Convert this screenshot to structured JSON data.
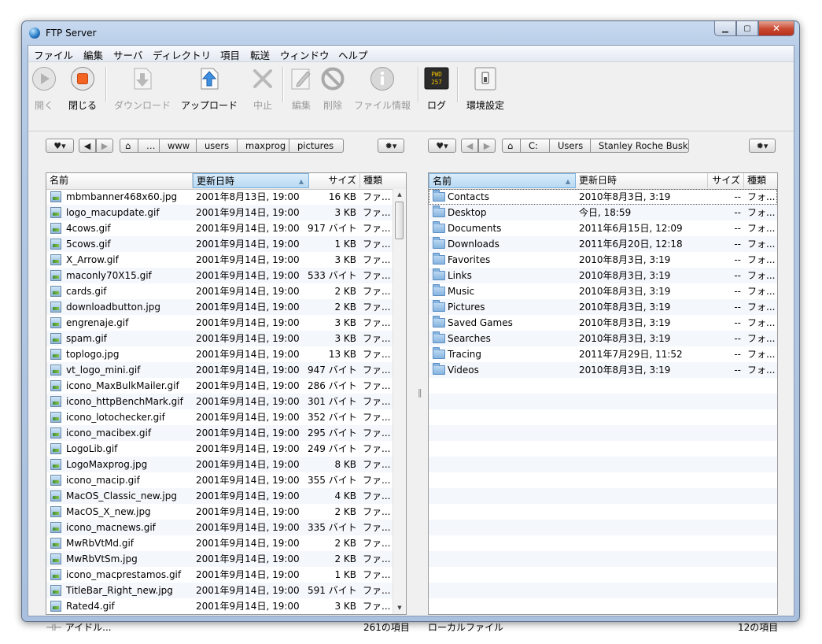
{
  "window": {
    "title": "FTP Server"
  },
  "menu": [
    "ファイル",
    "編集",
    "サーバ",
    "ディレクトリ",
    "項目",
    "転送",
    "ウィンドウ",
    "ヘルプ"
  ],
  "toolbar": {
    "open": "開く",
    "close": "閉じる",
    "download": "ダウンロード",
    "upload": "アップロード",
    "abort": "中止",
    "edit": "編集",
    "delete": "削除",
    "file_info": "ファイル情報",
    "log": "ログ",
    "log_icon_text": "PWD 257",
    "settings": "環境設定"
  },
  "remote_path": [
    "…",
    "www",
    "users",
    "maxprog",
    "pictures"
  ],
  "local_path": [
    "C:",
    "Users",
    "Stanley Roche Busk"
  ],
  "columns": {
    "name": "名前",
    "modified": "更新日時",
    "size": "サイズ",
    "kind": "種類"
  },
  "remote_files": [
    {
      "name": "mbmbanner468x60.jpg",
      "date": "2001年8月13日, 19:00",
      "size": "16 KB",
      "kind": "ファ..."
    },
    {
      "name": "logo_macupdate.gif",
      "date": "2001年9月14日, 19:00",
      "size": "3 KB",
      "kind": "ファ..."
    },
    {
      "name": "4cows.gif",
      "date": "2001年9月14日, 19:00",
      "size": "917 バイト",
      "kind": "ファ..."
    },
    {
      "name": "5cows.gif",
      "date": "2001年9月14日, 19:00",
      "size": "1 KB",
      "kind": "ファ..."
    },
    {
      "name": "X_Arrow.gif",
      "date": "2001年9月14日, 19:00",
      "size": "3 KB",
      "kind": "ファ..."
    },
    {
      "name": "maconly70X15.gif",
      "date": "2001年9月14日, 19:00",
      "size": "533 バイト",
      "kind": "ファ..."
    },
    {
      "name": "cards.gif",
      "date": "2001年9月14日, 19:00",
      "size": "2 KB",
      "kind": "ファ..."
    },
    {
      "name": "downloadbutton.jpg",
      "date": "2001年9月14日, 19:00",
      "size": "2 KB",
      "kind": "ファ..."
    },
    {
      "name": "engrenaje.gif",
      "date": "2001年9月14日, 19:00",
      "size": "3 KB",
      "kind": "ファ..."
    },
    {
      "name": "spam.gif",
      "date": "2001年9月14日, 19:00",
      "size": "3 KB",
      "kind": "ファ..."
    },
    {
      "name": "toplogo.jpg",
      "date": "2001年9月14日, 19:00",
      "size": "13 KB",
      "kind": "ファ..."
    },
    {
      "name": "vt_logo_mini.gif",
      "date": "2001年9月14日, 19:00",
      "size": "947 バイト",
      "kind": "ファ..."
    },
    {
      "name": "icono_MaxBulkMailer.gif",
      "date": "2001年9月14日, 19:00",
      "size": "286 バイト",
      "kind": "ファ..."
    },
    {
      "name": "icono_httpBenchMark.gif",
      "date": "2001年9月14日, 19:00",
      "size": "301 バイト",
      "kind": "ファ..."
    },
    {
      "name": "icono_lotochecker.gif",
      "date": "2001年9月14日, 19:00",
      "size": "352 バイト",
      "kind": "ファ..."
    },
    {
      "name": "icono_macibex.gif",
      "date": "2001年9月14日, 19:00",
      "size": "295 バイト",
      "kind": "ファ..."
    },
    {
      "name": "LogoLib.gif",
      "date": "2001年9月14日, 19:00",
      "size": "249 バイト",
      "kind": "ファ..."
    },
    {
      "name": "LogoMaxprog.jpg",
      "date": "2001年9月14日, 19:00",
      "size": "8 KB",
      "kind": "ファ..."
    },
    {
      "name": "icono_macip.gif",
      "date": "2001年9月14日, 19:00",
      "size": "355 バイト",
      "kind": "ファ..."
    },
    {
      "name": "MacOS_Classic_new.jpg",
      "date": "2001年9月14日, 19:00",
      "size": "4 KB",
      "kind": "ファ..."
    },
    {
      "name": "MacOS_X_new.jpg",
      "date": "2001年9月14日, 19:00",
      "size": "2 KB",
      "kind": "ファ..."
    },
    {
      "name": "icono_macnews.gif",
      "date": "2001年9月14日, 19:00",
      "size": "335 バイト",
      "kind": "ファ..."
    },
    {
      "name": "MwRbVtMd.gif",
      "date": "2001年9月14日, 19:00",
      "size": "2 KB",
      "kind": "ファ..."
    },
    {
      "name": "MwRbVtSm.jpg",
      "date": "2001年9月14日, 19:00",
      "size": "2 KB",
      "kind": "ファ..."
    },
    {
      "name": "icono_macprestamos.gif",
      "date": "2001年9月14日, 19:00",
      "size": "1 KB",
      "kind": "ファ..."
    },
    {
      "name": "TitleBar_Right_new.jpg",
      "date": "2001年9月14日, 19:00",
      "size": "591 バイト",
      "kind": "ファ..."
    },
    {
      "name": "Rated4.gif",
      "date": "2001年9月14日, 19:00",
      "size": "3 KB",
      "kind": "ファ..."
    }
  ],
  "local_files": [
    {
      "name": "Contacts",
      "date": "2010年8月3日, 3:19",
      "size": "--",
      "kind": "フォ..."
    },
    {
      "name": "Desktop",
      "date": "今日, 18:59",
      "size": "--",
      "kind": "フォ..."
    },
    {
      "name": "Documents",
      "date": "2011年6月15日, 12:09",
      "size": "--",
      "kind": "フォ..."
    },
    {
      "name": "Downloads",
      "date": "2011年6月20日, 12:18",
      "size": "--",
      "kind": "フォ..."
    },
    {
      "name": "Favorites",
      "date": "2010年8月3日, 3:19",
      "size": "--",
      "kind": "フォ..."
    },
    {
      "name": "Links",
      "date": "2010年8月3日, 3:19",
      "size": "--",
      "kind": "フォ..."
    },
    {
      "name": "Music",
      "date": "2010年8月3日, 3:19",
      "size": "--",
      "kind": "フォ..."
    },
    {
      "name": "Pictures",
      "date": "2010年8月3日, 3:19",
      "size": "--",
      "kind": "フォ..."
    },
    {
      "name": "Saved Games",
      "date": "2010年8月3日, 3:19",
      "size": "--",
      "kind": "フォ..."
    },
    {
      "name": "Searches",
      "date": "2010年8月3日, 3:19",
      "size": "--",
      "kind": "フォ..."
    },
    {
      "name": "Tracing",
      "date": "2011年7月29日, 11:52",
      "size": "--",
      "kind": "フォ..."
    },
    {
      "name": "Videos",
      "date": "2010年8月3日, 3:19",
      "size": "--",
      "kind": "フォ..."
    }
  ],
  "status": {
    "remote_state": "アイドル...",
    "remote_count": "261の項目",
    "local_label": "ローカルファイル",
    "local_count": "12の項目"
  },
  "icons": {
    "open": "play-icon",
    "close": "stop-icon",
    "download": "download-arrow-icon",
    "upload": "upload-arrow-icon",
    "abort": "x-icon",
    "edit": "pencil-icon",
    "delete": "no-entry-icon",
    "info": "info-icon",
    "log": "terminal-icon",
    "settings": "switch-icon",
    "favorites": "heart-icon",
    "home": "home-icon",
    "gear": "gear-icon",
    "image_file": "image-file-icon",
    "folder": "folder-icon"
  },
  "colors": {
    "sorted_header": "#b8d9f3",
    "titlebar": "#c7d9ef",
    "stop_button": "#f26522"
  }
}
